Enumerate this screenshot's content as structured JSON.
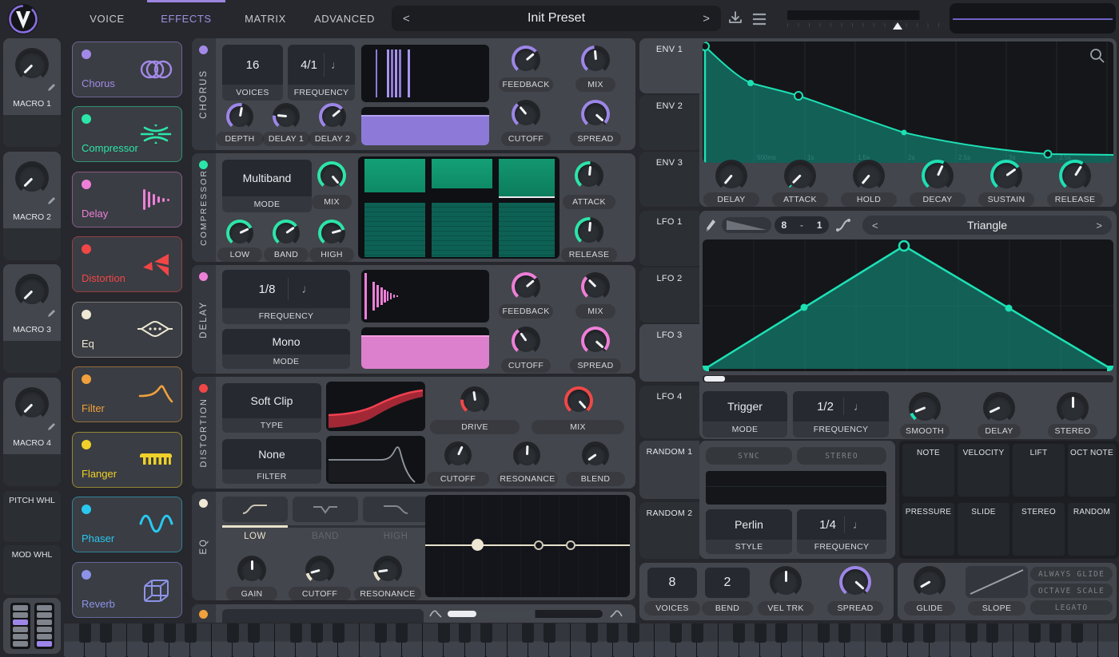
{
  "colors": {
    "purple": "#9d86e8",
    "teal": "#2ce5a8",
    "pink": "#ee7fd8",
    "red": "#f04848",
    "cream": "#e8e2cc",
    "orange": "#f0a03c",
    "yellow": "#f0d02a",
    "cyan": "#29c8f0",
    "lavender": "#8d93e8",
    "graph_teal": "#1de0b4"
  },
  "icons": {
    "note": "♩",
    "prev": "<",
    "next": ">"
  },
  "topbar": {
    "tabs": [
      "VOICE",
      "EFFECTS",
      "MATRIX",
      "ADVANCED"
    ],
    "active_tab": "EFFECTS",
    "preset_name": "Init Preset"
  },
  "sidebar": {
    "macros": [
      "MACRO 1",
      "MACRO 2",
      "MACRO 3",
      "MACRO 4"
    ],
    "pitch_wheel": "PITCH WHL",
    "mod_wheel": "MOD WHL"
  },
  "effects_list": [
    {
      "name": "Chorus",
      "color": "#a289e8"
    },
    {
      "name": "Compressor",
      "color": "#2ce5a8"
    },
    {
      "name": "Delay",
      "color": "#ee7fd8"
    },
    {
      "name": "Distortion",
      "color": "#f04646"
    },
    {
      "name": "Eq",
      "color": "#eee8d5"
    },
    {
      "name": "Filter",
      "color": "#f0a03c"
    },
    {
      "name": "Flanger",
      "color": "#f0d02a"
    },
    {
      "name": "Phaser",
      "color": "#29c8f0"
    },
    {
      "name": "Reverb",
      "color": "#8d93e8"
    }
  ],
  "fx": {
    "chorus": {
      "title": "CHORUS",
      "voices": "16",
      "voices_label": "VOICES",
      "freq": "4/1",
      "freq_label": "FREQUENCY",
      "depth": "DEPTH",
      "delay1": "DELAY 1",
      "delay2": "DELAY 2",
      "feedback": "FEEDBACK",
      "mix": "MIX",
      "cutoff": "CUTOFF",
      "spread": "SPREAD"
    },
    "compressor": {
      "title": "COMPRESSOR",
      "mode": "Multiband",
      "mode_label": "MODE",
      "mix": "MIX",
      "low": "LOW",
      "band": "BAND",
      "high": "HIGH",
      "attack": "ATTACK",
      "release": "RELEASE"
    },
    "delay": {
      "title": "DELAY",
      "freq": "1/8",
      "freq_label": "FREQUENCY",
      "mode": "Mono",
      "mode_label": "MODE",
      "feedback": "FEEDBACK",
      "mix": "MIX",
      "cutoff": "CUTOFF",
      "spread": "SPREAD"
    },
    "distortion": {
      "title": "DISTORTION",
      "type": "Soft Clip",
      "type_label": "TYPE",
      "filter": "None",
      "filter_label": "FILTER",
      "drive": "DRIVE",
      "mix": "MIX",
      "cutoff": "CUTOFF",
      "resonance": "RESONANCE",
      "blend": "BLEND"
    },
    "eq": {
      "title": "EQ",
      "low": "LOW",
      "band": "BAND",
      "high": "HIGH",
      "gain": "GAIN",
      "cutoff": "CUTOFF",
      "resonance": "RESONANCE"
    }
  },
  "env": {
    "tabs": [
      "ENV 1",
      "ENV 2",
      "ENV 3"
    ],
    "delay": "DELAY",
    "attack": "ATTACK",
    "hold": "HOLD",
    "decay": "DECAY",
    "sustain": "SUSTAIN",
    "release": "RELEASE",
    "times": [
      "500ms",
      "1s",
      "1.5s",
      "2s",
      "2.5s",
      "3s",
      "3.5s"
    ]
  },
  "lfo": {
    "tabs": [
      "LFO 1",
      "LFO 2",
      "LFO 3",
      "LFO 4"
    ],
    "grid_rows": "8",
    "grid_dash": "-",
    "grid_cols": "1",
    "shape": "Triangle",
    "mode": "Trigger",
    "mode_label": "MODE",
    "freq": "1/2",
    "freq_label": "FREQUENCY",
    "smooth": "SMOOTH",
    "delay": "DELAY",
    "stereo": "STEREO"
  },
  "random": {
    "tabs": [
      "RANDOM 1",
      "RANDOM 2"
    ],
    "sync": "SYNC",
    "stereo": "STEREO",
    "style": "Perlin",
    "style_label": "STYLE",
    "freq": "1/4",
    "freq_label": "FREQUENCY"
  },
  "mod_sources": [
    "NOTE",
    "VELOCITY",
    "LIFT",
    "OCT NOTE",
    "PRESSURE",
    "SLIDE",
    "STEREO",
    "RANDOM"
  ],
  "voice": {
    "voices": "8",
    "voices_label": "VOICES",
    "bend": "2",
    "bend_label": "BEND",
    "vel_trk": "VEL TRK",
    "spread": "SPREAD",
    "glide": "GLIDE",
    "slope": "SLOPE",
    "always_glide": "ALWAYS GLIDE",
    "octave_scale": "OCTAVE SCALE",
    "legato": "LEGATO"
  }
}
